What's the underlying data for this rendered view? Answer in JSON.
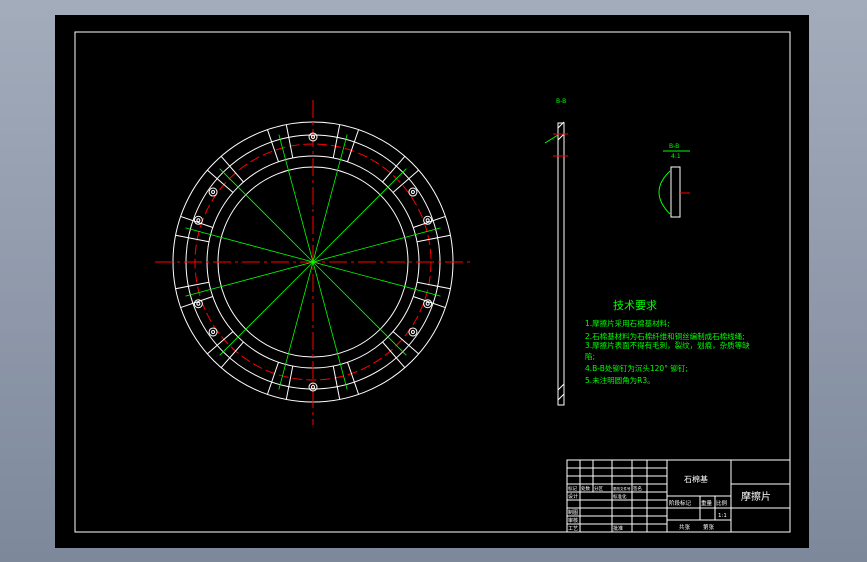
{
  "drawing": {
    "tech_requirements": {
      "title": "技术要求",
      "items": [
        "1.摩擦片采用石棉基材料;",
        "2.石棉基材料为石棉纤维和铜丝编制成石棉线绳;",
        "3.摩擦片表面不得有毛刺，裂纹，划痕，杂质等缺",
        "陷;",
        "4.B-B处铆钉为沉头120° 铆钉;",
        "5.未注明圆角为R3。"
      ]
    },
    "section_label": "B-B",
    "detail_scale": "4:1",
    "title_block": {
      "material": "石棉基",
      "part_name": "摩擦片",
      "revision_headers": [
        "标记",
        "处数",
        "分区",
        "更改文件号",
        "签名"
      ],
      "roles": [
        "设计",
        "制图",
        "审核",
        "工艺"
      ],
      "standardization": "标准化",
      "approve": "批准",
      "stage_mark": "阶段标记",
      "weight": "重量",
      "scale_label": "比例",
      "scale": "1:1",
      "sheets_total": "共张",
      "sheet_no": "第张"
    },
    "colors": {
      "background": "#000000",
      "lines": "#ffffff",
      "dimensions": "#00ff00",
      "centerlines": "#ff0000"
    }
  }
}
